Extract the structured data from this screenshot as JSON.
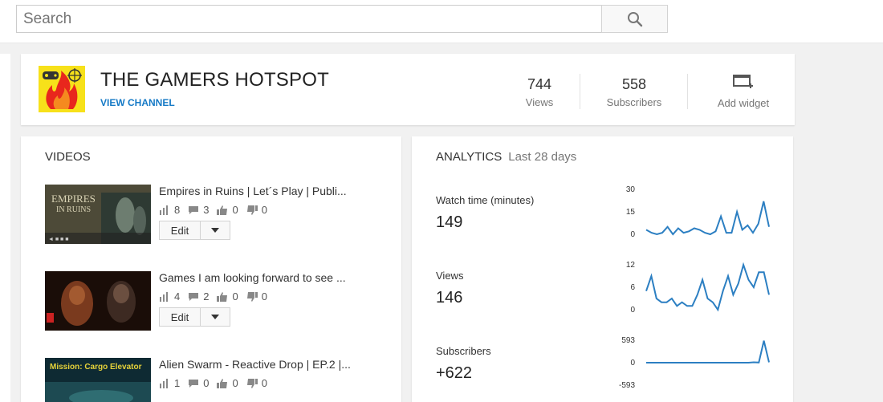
{
  "search": {
    "placeholder": "Search",
    "value": ""
  },
  "channel": {
    "name": "THE GAMERS HOTSPOT",
    "view_channel_label": "VIEW CHANNEL",
    "logo_icon": "gamer-flame-logo",
    "stats": [
      {
        "value": "744",
        "label": "Views"
      },
      {
        "value": "558",
        "label": "Subscribers"
      }
    ],
    "add_widget_label": "Add widget"
  },
  "videos": {
    "title": "VIDEOS",
    "edit_label": "Edit",
    "items": [
      {
        "title": "Empires in Ruins | Let´s Play | Publi...",
        "views": "8",
        "comments": "3",
        "likes": "0",
        "dislikes": "0"
      },
      {
        "title": "Games I am looking forward to see ...",
        "views": "4",
        "comments": "2",
        "likes": "0",
        "dislikes": "0"
      },
      {
        "title": "Alien Swarm - Reactive Drop | EP.2 |...",
        "views": "1",
        "comments": "0",
        "likes": "0",
        "dislikes": "0"
      }
    ]
  },
  "analytics": {
    "title": "ANALYTICS",
    "period": "Last 28 days",
    "metrics": [
      {
        "label": "Watch time (minutes)",
        "value": "149",
        "ticks": [
          "30",
          "15",
          "0"
        ],
        "ymin": 0,
        "ymax": 30,
        "series": [
          3,
          1,
          0,
          1,
          5,
          0,
          4,
          1,
          2,
          4,
          3,
          1,
          0,
          2,
          12,
          1,
          1,
          15,
          3,
          6,
          1,
          7,
          22,
          5
        ]
      },
      {
        "label": "Views",
        "value": "146",
        "ticks": [
          "12",
          "6",
          "0"
        ],
        "ymin": 0,
        "ymax": 12,
        "series": [
          5,
          9,
          3,
          2,
          2,
          3,
          1,
          2,
          1,
          1,
          4,
          8,
          3,
          2,
          0,
          5,
          9,
          4,
          7,
          12,
          8,
          6,
          10,
          10,
          4
        ]
      },
      {
        "label": "Subscribers",
        "value": "+622",
        "ticks": [
          "593",
          "0",
          "-593"
        ],
        "ymin": -593,
        "ymax": 593,
        "series": [
          0,
          0,
          0,
          0,
          0,
          0,
          0,
          0,
          0,
          0,
          0,
          0,
          0,
          0,
          0,
          0,
          0,
          0,
          0,
          0,
          0,
          10,
          5,
          580,
          10
        ]
      }
    ]
  },
  "colors": {
    "accent": "#167ac6",
    "spark_line": "#2c7fc2"
  }
}
